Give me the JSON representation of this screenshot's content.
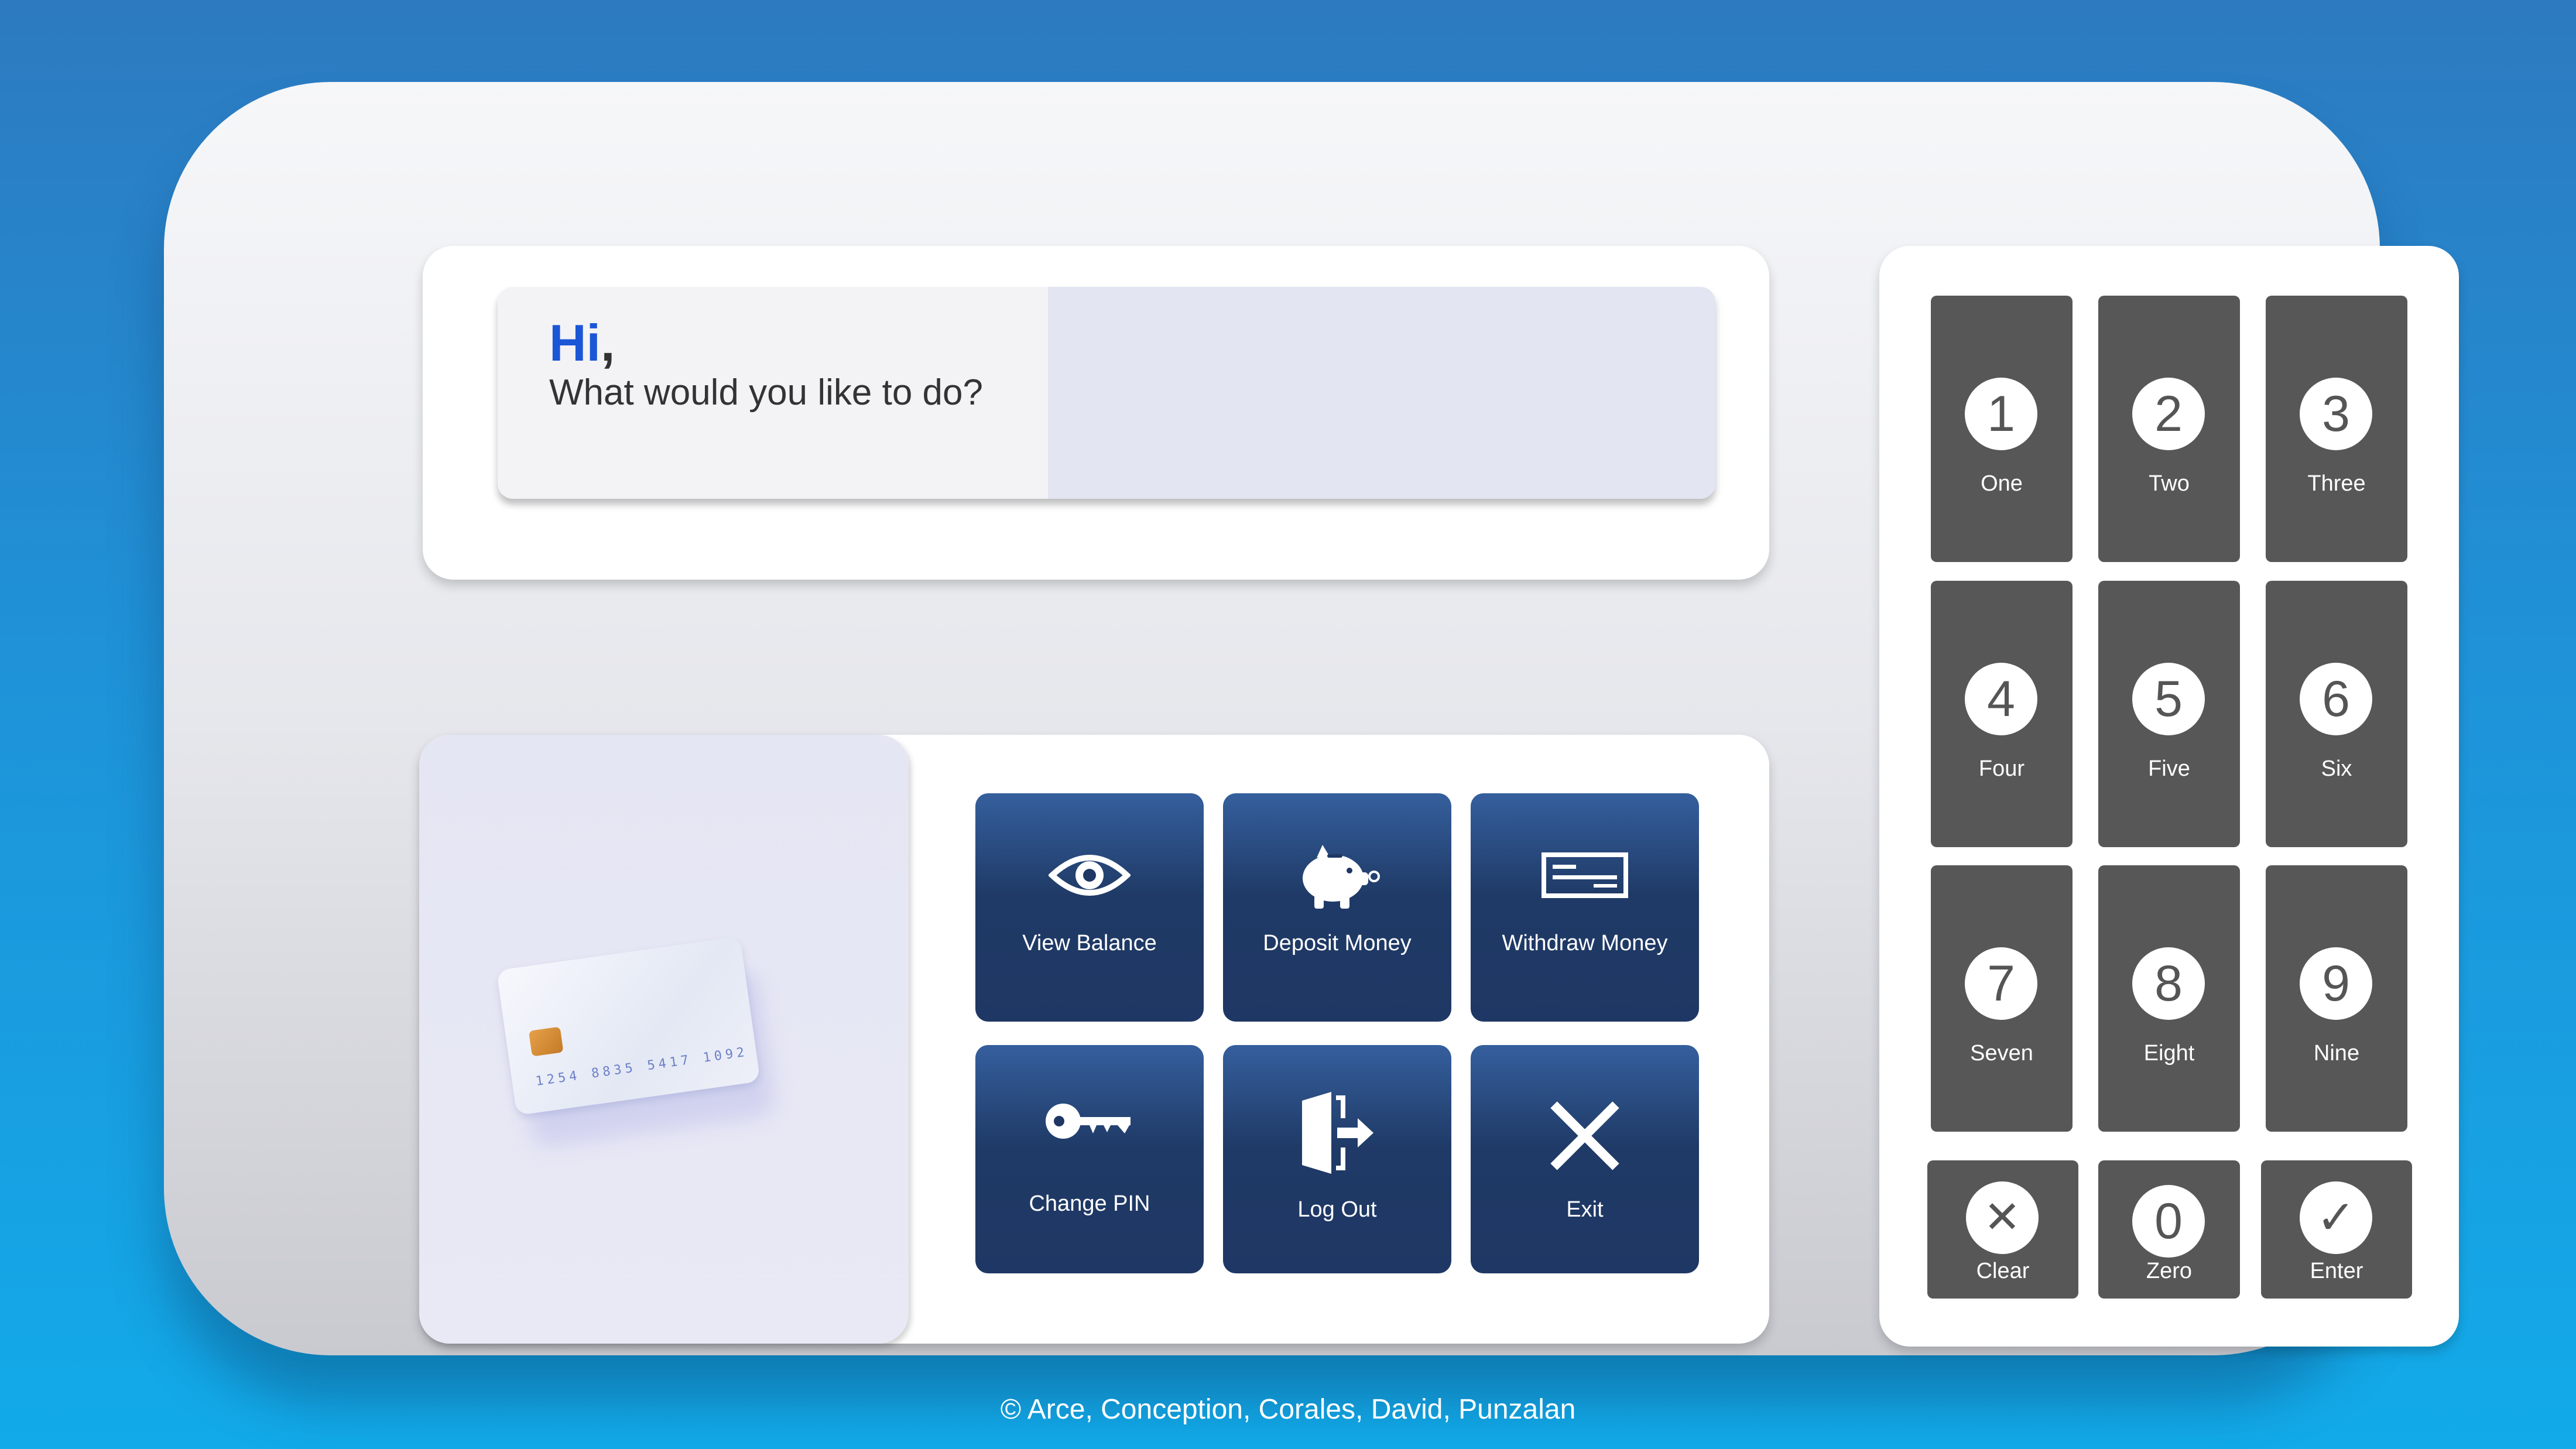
{
  "greeting": {
    "hi": "Hi",
    "comma": ",",
    "question": "What would you like to do?"
  },
  "card": {
    "number": "1254 8835 5417 1092"
  },
  "menu": {
    "items": [
      {
        "label": "View Balance",
        "icon": "eye-icon"
      },
      {
        "label": "Deposit Money",
        "icon": "piggy-bank-icon"
      },
      {
        "label": "Withdraw Money",
        "icon": "check-icon"
      },
      {
        "label": "Change PIN",
        "icon": "key-icon"
      },
      {
        "label": "Log Out",
        "icon": "logout-door-icon"
      },
      {
        "label": "Exit",
        "icon": "close-icon"
      }
    ]
  },
  "keypad": {
    "keys": [
      {
        "digit": "1",
        "word": "One"
      },
      {
        "digit": "2",
        "word": "Two"
      },
      {
        "digit": "3",
        "word": "Three"
      },
      {
        "digit": "4",
        "word": "Four"
      },
      {
        "digit": "5",
        "word": "Five"
      },
      {
        "digit": "6",
        "word": "Six"
      },
      {
        "digit": "7",
        "word": "Seven"
      },
      {
        "digit": "8",
        "word": "Eight"
      },
      {
        "digit": "9",
        "word": "Nine"
      }
    ],
    "clear": {
      "symbol": "✕",
      "word": "Clear"
    },
    "zero": {
      "digit": "0",
      "word": "Zero"
    },
    "enter": {
      "symbol": "✓",
      "word": "Enter"
    }
  },
  "footer": {
    "credits": "© Arce, Conception, Corales, David, Punzalan"
  },
  "colors": {
    "accent": "#1a56d6",
    "button": "#1f3764",
    "key": "#575757"
  }
}
